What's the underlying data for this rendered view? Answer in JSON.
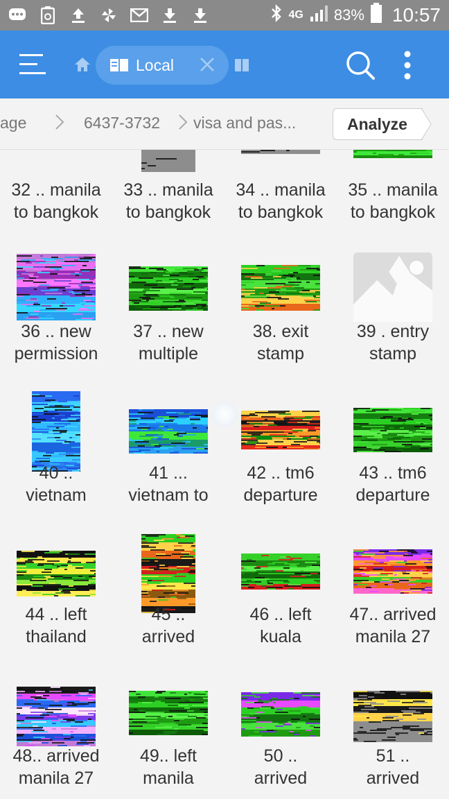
{
  "status_bar": {
    "network": "4G",
    "battery": "83%",
    "time": "10:57"
  },
  "app_bar": {
    "tab_label": "Local"
  },
  "breadcrumb": {
    "items": [
      "age",
      "6437-3732",
      "visa and  pas..."
    ],
    "analyze_label": "Analyze"
  },
  "colors": {
    "app_bar": "#3c8de3",
    "tab_chip": "#5aa0ea",
    "status_bar": "#8a8a8a",
    "background": "#f3f3f3"
  },
  "files": [
    {
      "line1": "32 .. manila",
      "line2": "to bangkok",
      "thumb": "blue-strip"
    },
    {
      "line1": "33 .. manila",
      "line2": "to bangkok",
      "thumb": "gray-block"
    },
    {
      "line1": "34 .. manila",
      "line2": "to bangkok",
      "thumb": "gray-strip"
    },
    {
      "line1": "35 .. manila",
      "line2": "to bangkok",
      "thumb": "green-strip"
    },
    {
      "line1": "36 .. new",
      "line2": "permission",
      "thumb": "magenta-cyan"
    },
    {
      "line1": "37 .. new",
      "line2": "multiple",
      "thumb": "green"
    },
    {
      "line1": "38. exit",
      "line2": "stamp",
      "thumb": "green-orange"
    },
    {
      "line1": "39 . entry",
      "line2": "stamp",
      "thumb": "broken-image"
    },
    {
      "line1": "40 ..",
      "line2": "vietnam",
      "thumb": "blue-portrait"
    },
    {
      "line1": "41 ...",
      "line2": "vietnam to",
      "thumb": "blue-green"
    },
    {
      "line1": "42 .. tm6",
      "line2": "departure",
      "thumb": "orange-red"
    },
    {
      "line1": "43 .. tm6",
      "line2": "departure",
      "thumb": "green"
    },
    {
      "line1": "44 .. left",
      "line2": "thailand",
      "thumb": "yellow-green"
    },
    {
      "line1": "45 ..",
      "line2": "arrived",
      "thumb": "rainbow-portrait"
    },
    {
      "line1": "46 .. left",
      "line2": "kuala",
      "thumb": "green-red"
    },
    {
      "line1": "47.. arrived",
      "line2": "manila 27",
      "thumb": "purple-orange"
    },
    {
      "line1": "48.. arrived",
      "line2": "manila 27",
      "thumb": "purple-blue"
    },
    {
      "line1": "49.. left",
      "line2": "manila",
      "thumb": "green"
    },
    {
      "line1": "50 ..",
      "line2": "arrived",
      "thumb": "purple-green"
    },
    {
      "line1": "51 ..",
      "line2": "arrived",
      "thumb": "yellow-gray"
    }
  ]
}
